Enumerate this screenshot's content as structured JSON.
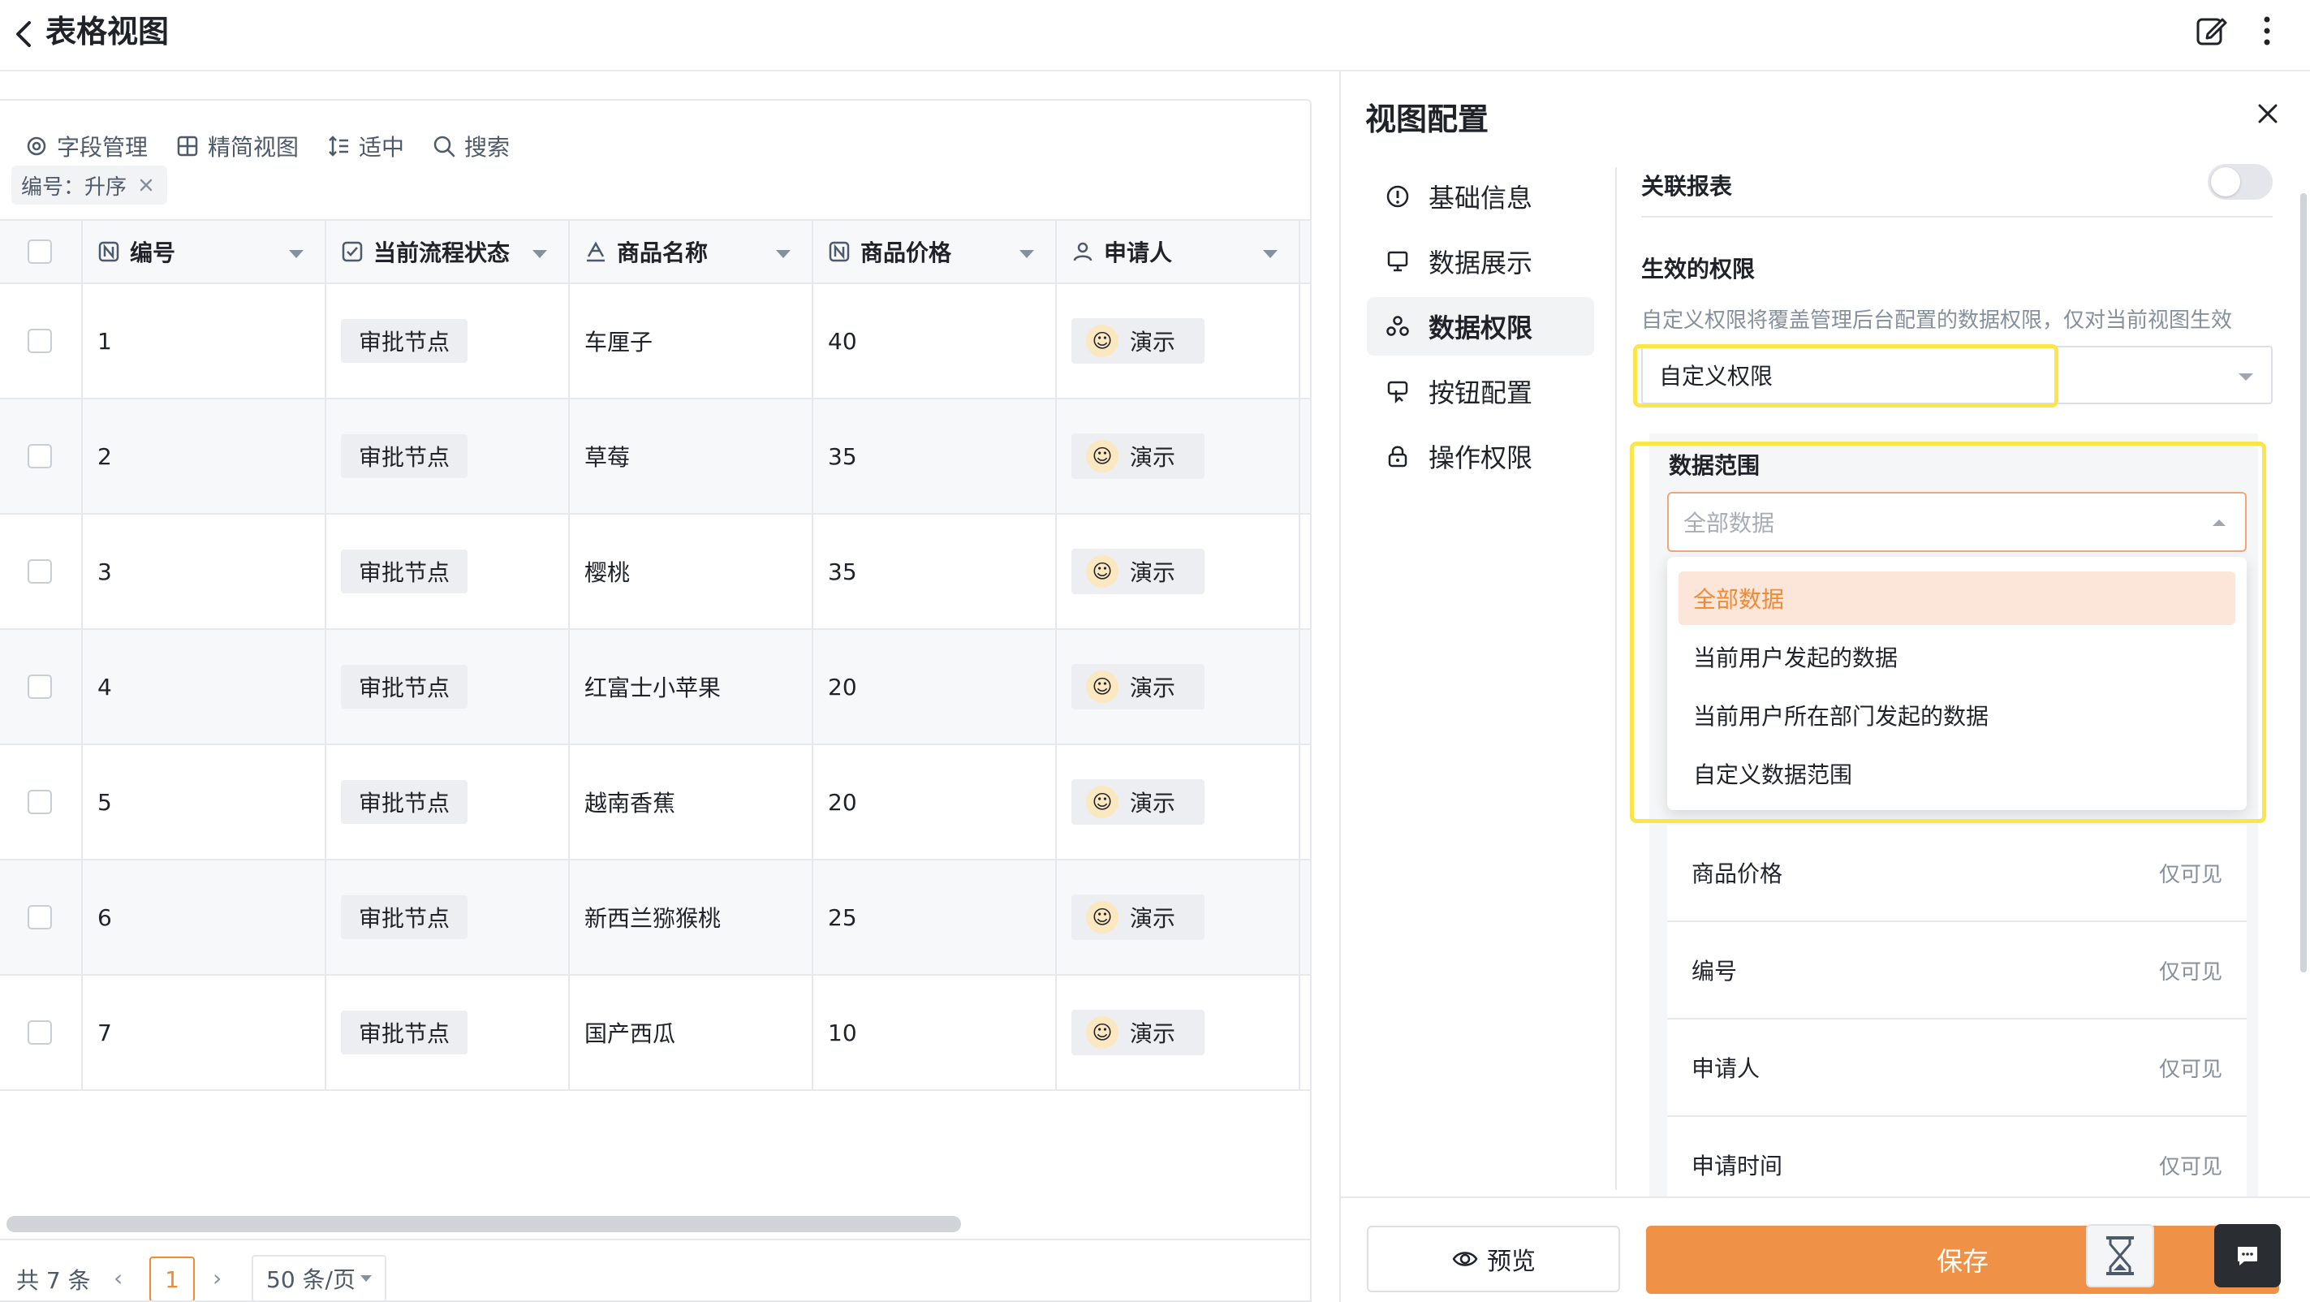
{
  "header": {
    "title": "表格视图"
  },
  "toolbar": {
    "field_manage": "字段管理",
    "compact_view": "精简视图",
    "row_height": "适中",
    "search": "搜索"
  },
  "sort_chip": {
    "label": "编号：升序"
  },
  "table": {
    "columns": [
      "编号",
      "当前流程状态",
      "商品名称",
      "商品价格",
      "申请人"
    ],
    "rows": [
      {
        "id": "1",
        "status": "审批节点",
        "name": "车厘子",
        "price": "40",
        "applicant": "演示"
      },
      {
        "id": "2",
        "status": "审批节点",
        "name": "草莓",
        "price": "35",
        "applicant": "演示"
      },
      {
        "id": "3",
        "status": "审批节点",
        "name": "樱桃",
        "price": "35",
        "applicant": "演示"
      },
      {
        "id": "4",
        "status": "审批节点",
        "name": "红富士小苹果",
        "price": "20",
        "applicant": "演示"
      },
      {
        "id": "5",
        "status": "审批节点",
        "name": "越南香蕉",
        "price": "20",
        "applicant": "演示"
      },
      {
        "id": "6",
        "status": "审批节点",
        "name": "新西兰猕猴桃",
        "price": "25",
        "applicant": "演示"
      },
      {
        "id": "7",
        "status": "审批节点",
        "name": "国产西瓜",
        "price": "10",
        "applicant": "演示"
      }
    ]
  },
  "pagination": {
    "total": "共 7 条",
    "prev": "‹",
    "current": "1",
    "next": "›",
    "page_size": "50 条/页"
  },
  "panel": {
    "title": "视图配置",
    "nav": [
      "基础信息",
      "数据展示",
      "数据权限",
      "按钮配置",
      "操作权限"
    ],
    "active_nav": "数据权限",
    "linked_report": "关联报表",
    "effective_permission": "生效的权限",
    "permission_desc": "自定义权限将覆盖管理后台配置的数据权限，仅对当前视图生效",
    "permission_value": "自定义权限",
    "data_range_label": "数据范围",
    "data_range_placeholder": "全部数据",
    "data_range_options": [
      "全部数据",
      "当前用户发起的数据",
      "当前用户所在部门发起的数据",
      "自定义数据范围"
    ],
    "fields": [
      {
        "name": "商品价格",
        "perm": "仅可见"
      },
      {
        "name": "编号",
        "perm": "仅可见"
      },
      {
        "name": "申请人",
        "perm": "仅可见"
      },
      {
        "name": "申请时间",
        "perm": "仅可见"
      }
    ],
    "preview_label": "预览",
    "save_label": "保存"
  },
  "colors": {
    "accent": "#ef9146",
    "highlight": "#fae54a",
    "selected_option_bg": "#fce6da"
  },
  "icons": [
    "back-arrow-icon",
    "edit-icon",
    "more-icon",
    "field-manage-icon",
    "compact-view-icon",
    "row-height-icon",
    "search-icon",
    "close-icon",
    "info-icon",
    "display-icon",
    "permission-icon",
    "button-config-icon",
    "lock-icon",
    "eye-icon",
    "hourglass-icon",
    "chat-icon"
  ]
}
